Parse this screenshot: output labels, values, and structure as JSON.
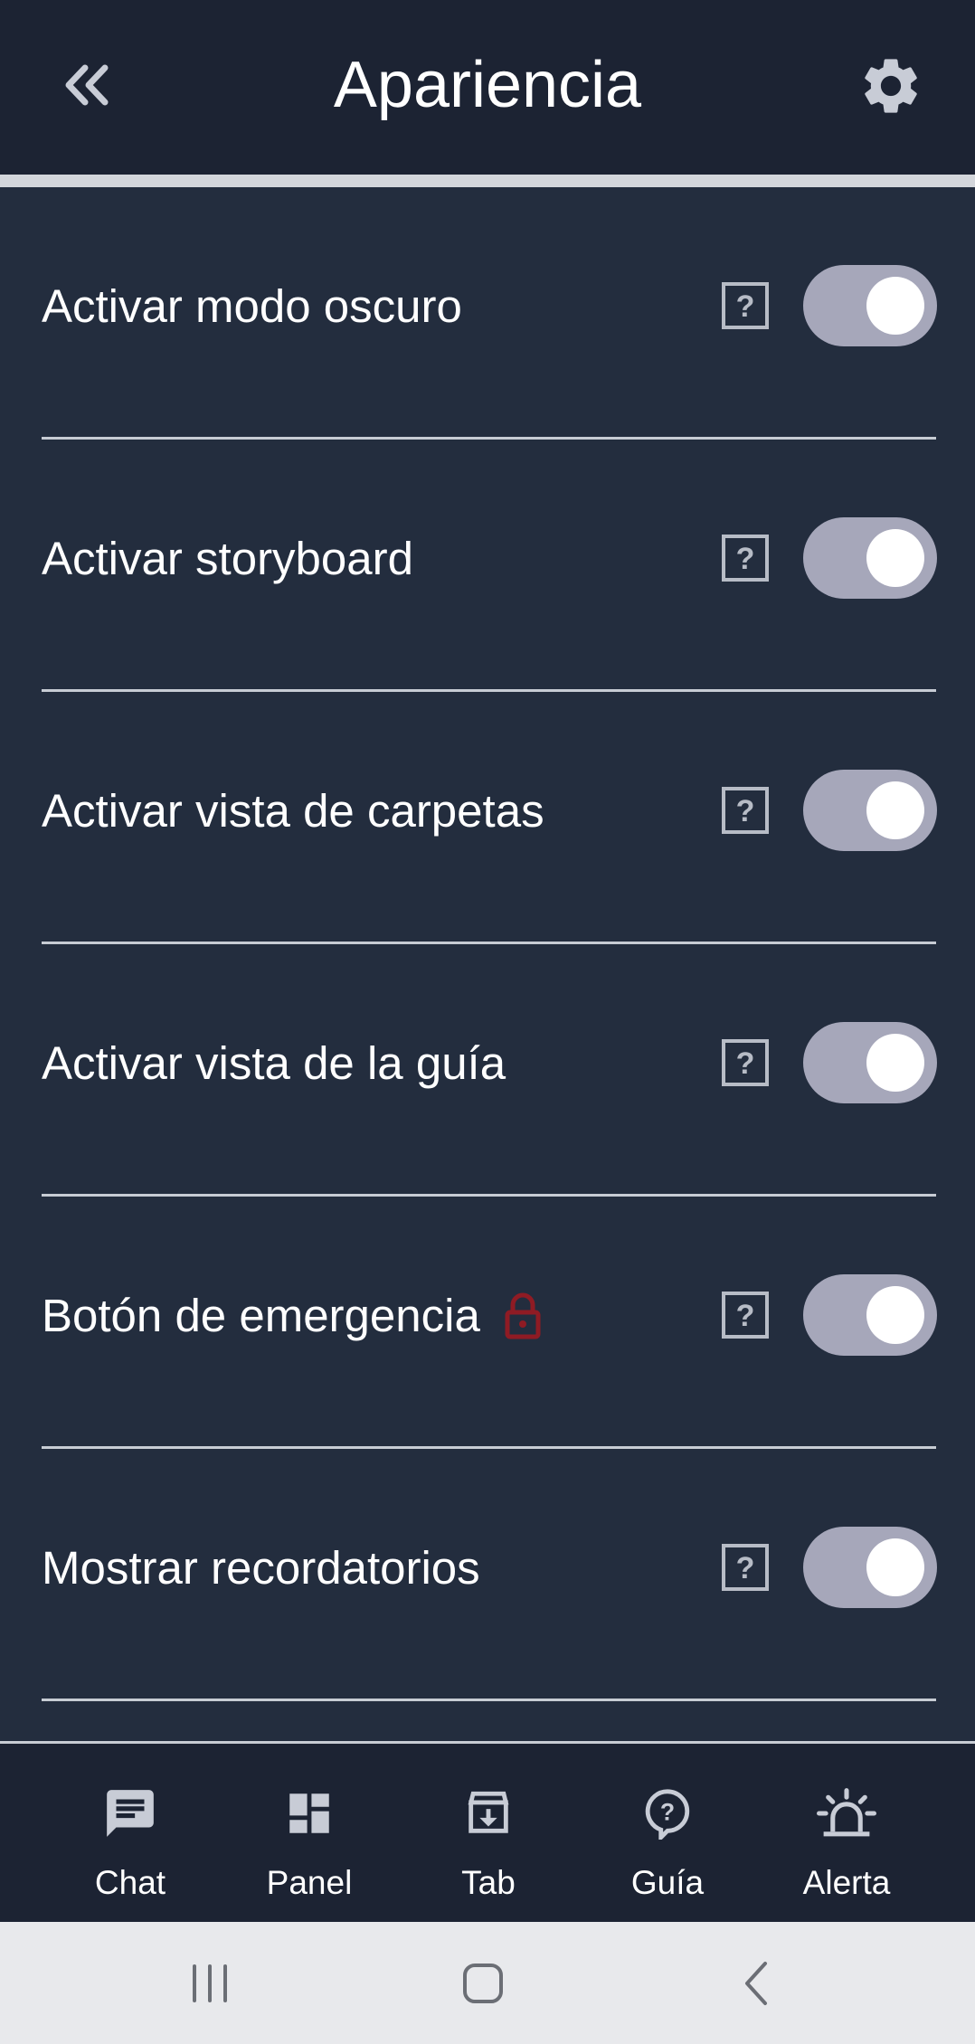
{
  "header": {
    "title": "Apariencia",
    "back_icon": "double-chevron-left-icon",
    "settings_icon": "gear-icon"
  },
  "settings": [
    {
      "label": "Activar modo oscuro",
      "enabled": true,
      "locked": false
    },
    {
      "label": "Activar storyboard",
      "enabled": true,
      "locked": false
    },
    {
      "label": "Activar vista de carpetas",
      "enabled": true,
      "locked": false
    },
    {
      "label": "Activar vista de la guía",
      "enabled": true,
      "locked": false
    },
    {
      "label": "Botón de emergencia",
      "enabled": true,
      "locked": true
    },
    {
      "label": "Mostrar recordatorios",
      "enabled": true,
      "locked": false
    }
  ],
  "bottom_nav": [
    {
      "label": "Chat",
      "icon": "chat-icon"
    },
    {
      "label": "Panel",
      "icon": "dashboard-icon"
    },
    {
      "label": "Tab",
      "icon": "archive-download-icon"
    },
    {
      "label": "Guía",
      "icon": "help-bubble-icon"
    },
    {
      "label": "Alerta",
      "icon": "siren-icon"
    }
  ],
  "colors": {
    "header_bg": "#1c2333",
    "page_bg": "#232d3e",
    "toggle_track": "#a6a7ba",
    "lock_red": "#8f1b24",
    "system_nav_bg": "#e8e9ec"
  }
}
